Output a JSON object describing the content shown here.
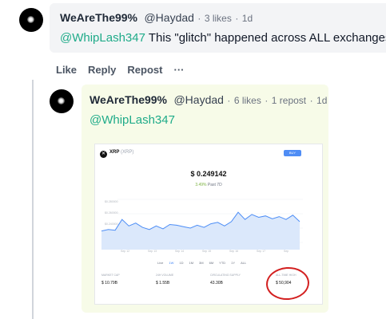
{
  "comment": {
    "author_name": "WeAreThe99%",
    "handle": "@Haydad",
    "likes": "3 likes",
    "time": "1d",
    "mention": "@WhipLash347",
    "text": " This \"glitch\" happened across ALL exchanges"
  },
  "actions": {
    "like": "Like",
    "reply": "Reply",
    "repost": "Repost",
    "more": "···"
  },
  "reply": {
    "author_name": "WeAreThe99%",
    "handle": "@Haydad",
    "likes": "6 likes",
    "reposts": "1 repost",
    "time": "1d",
    "mention": "@WhipLash347"
  },
  "separator": "·",
  "embed": {
    "coin_name": "XRP",
    "coin_symbol": "(XRP)",
    "buy_label": "BUY",
    "price": "$ 0.249142",
    "change_pct": "3.49%",
    "change_period": "Past 7D",
    "y_labels": [
      "$0.280000",
      "$0.260000",
      "$0.240000",
      "$0.220000"
    ],
    "x_labels": [
      "Sep 12",
      "Sep 13",
      "Sep 14",
      "Sep 15",
      "Sep 16",
      "Sep 17",
      "Sep"
    ],
    "ranges": [
      "Live",
      "1W",
      "1D",
      "1M",
      "3M",
      "6M",
      "YTD",
      "1Y",
      "ALL"
    ],
    "active_range": "1W",
    "stats": [
      {
        "label": "MARKET CAP",
        "value": "$ 10.79B"
      },
      {
        "label": "24H VOLUME",
        "value": "$ 1.55B"
      },
      {
        "label": "CIRCULATING SUPPLY",
        "value": "43.30B"
      },
      {
        "label": "ALL-TIME HIGH",
        "value": "$ 50,904"
      }
    ],
    "line_color": "#4c8df6",
    "highlight_color": "#d32020"
  },
  "chart_data": {
    "type": "area",
    "title": "XRP (XRP)",
    "xlabel": "",
    "ylabel": "",
    "categories": [
      "Sep 12",
      "Sep 13",
      "Sep 14",
      "Sep 15",
      "Sep 16",
      "Sep 17",
      "Sep"
    ],
    "ylim": [
      0.21,
      0.29
    ],
    "series": [
      {
        "values": [
          0.236,
          0.238,
          0.237,
          0.252,
          0.243,
          0.247,
          0.241,
          0.238,
          0.243,
          0.239,
          0.245,
          0.244,
          0.242,
          0.24,
          0.244,
          0.241,
          0.246,
          0.248,
          0.243,
          0.249,
          0.262,
          0.252,
          0.259,
          0.255,
          0.257,
          0.253,
          0.256,
          0.252,
          0.258,
          0.249
        ]
      }
    ],
    "grid": true,
    "legend": "none"
  }
}
